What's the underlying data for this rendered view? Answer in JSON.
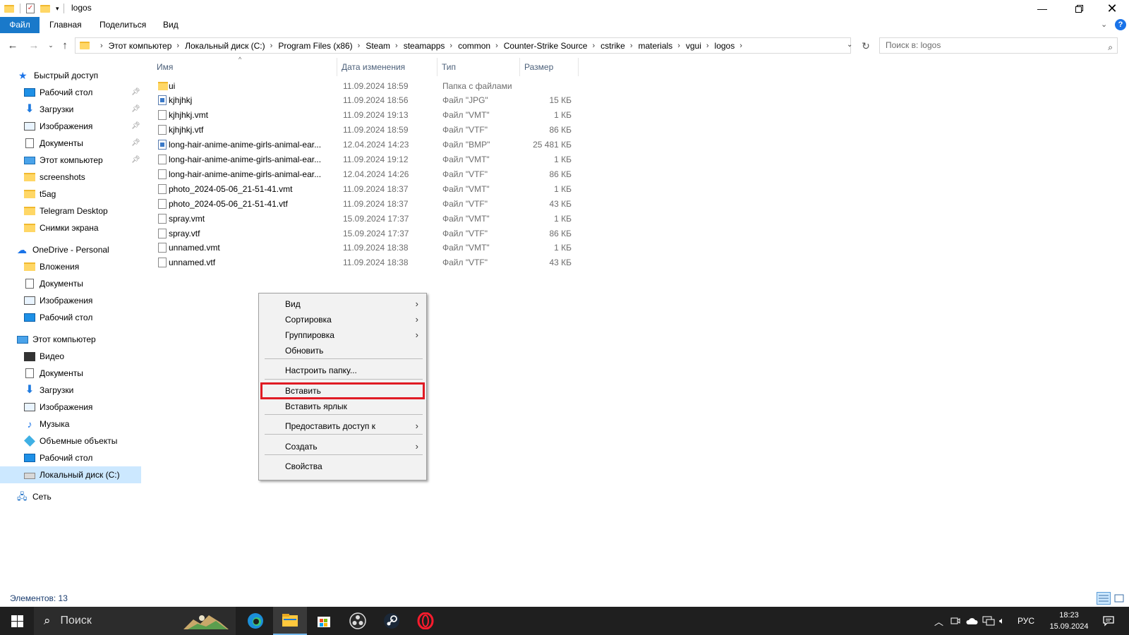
{
  "window": {
    "title": "logos"
  },
  "ribbon": {
    "tabs": [
      "Файл",
      "Главная",
      "Поделиться",
      "Вид"
    ]
  },
  "address": {
    "crumbs": [
      "Этот компьютер",
      "Локальный диск (C:)",
      "Program Files (x86)",
      "Steam",
      "steamapps",
      "common",
      "Counter-Strike Source",
      "cstrike",
      "materials",
      "vgui",
      "logos"
    ],
    "search_placeholder": "Поиск в: logos"
  },
  "nav": {
    "quick_access": "Быстрый доступ",
    "quick_items": [
      {
        "label": "Рабочий стол",
        "icon": "desktop-icon",
        "pinned": true
      },
      {
        "label": "Загрузки",
        "icon": "downloads-icon",
        "pinned": true
      },
      {
        "label": "Изображения",
        "icon": "pictures-icon",
        "pinned": true
      },
      {
        "label": "Документы",
        "icon": "documents-icon",
        "pinned": true
      },
      {
        "label": "Этот компьютер",
        "icon": "computer-icon",
        "pinned": true
      },
      {
        "label": "screenshots",
        "icon": "folder-icon",
        "pinned": false
      },
      {
        "label": "t5ag",
        "icon": "folder-icon",
        "pinned": false
      },
      {
        "label": "Telegram Desktop",
        "icon": "folder-icon",
        "pinned": false
      },
      {
        "label": "Снимки экрана",
        "icon": "folder-icon",
        "pinned": false
      }
    ],
    "onedrive": "OneDrive - Personal",
    "onedrive_items": [
      "Вложения",
      "Документы",
      "Изображения",
      "Рабочий стол"
    ],
    "this_pc": "Этот компьютер",
    "pc_items": [
      "Видео",
      "Документы",
      "Загрузки",
      "Изображения",
      "Музыка",
      "Объемные объекты",
      "Рабочий стол",
      "Локальный диск (C:)"
    ],
    "network": "Сеть"
  },
  "files": {
    "columns": [
      "Имя",
      "Дата изменения",
      "Тип",
      "Размер"
    ],
    "rows": [
      {
        "name": "ui",
        "date": "11.09.2024 18:59",
        "type": "Папка с файлами",
        "size": "",
        "kind": "folder"
      },
      {
        "name": "kjhjhkj",
        "date": "11.09.2024 18:56",
        "type": "Файл \"JPG\"",
        "size": "15 КБ",
        "kind": "image"
      },
      {
        "name": "kjhjhkj.vmt",
        "date": "11.09.2024 19:13",
        "type": "Файл \"VMT\"",
        "size": "1 КБ",
        "kind": "file"
      },
      {
        "name": "kjhjhkj.vtf",
        "date": "11.09.2024 18:59",
        "type": "Файл \"VTF\"",
        "size": "86 КБ",
        "kind": "file"
      },
      {
        "name": "long-hair-anime-anime-girls-animal-ear...",
        "date": "12.04.2024 14:23",
        "type": "Файл \"BMP\"",
        "size": "25 481 КБ",
        "kind": "image"
      },
      {
        "name": "long-hair-anime-anime-girls-animal-ear...",
        "date": "11.09.2024 19:12",
        "type": "Файл \"VMT\"",
        "size": "1 КБ",
        "kind": "file"
      },
      {
        "name": "long-hair-anime-anime-girls-animal-ear...",
        "date": "12.04.2024 14:26",
        "type": "Файл \"VTF\"",
        "size": "86 КБ",
        "kind": "file"
      },
      {
        "name": "photo_2024-05-06_21-51-41.vmt",
        "date": "11.09.2024 18:37",
        "type": "Файл \"VMT\"",
        "size": "1 КБ",
        "kind": "file"
      },
      {
        "name": "photo_2024-05-06_21-51-41.vtf",
        "date": "11.09.2024 18:37",
        "type": "Файл \"VTF\"",
        "size": "43 КБ",
        "kind": "file"
      },
      {
        "name": "spray.vmt",
        "date": "15.09.2024 17:37",
        "type": "Файл \"VMT\"",
        "size": "1 КБ",
        "kind": "file"
      },
      {
        "name": "spray.vtf",
        "date": "15.09.2024 17:37",
        "type": "Файл \"VTF\"",
        "size": "86 КБ",
        "kind": "file"
      },
      {
        "name": "unnamed.vmt",
        "date": "11.09.2024 18:38",
        "type": "Файл \"VMT\"",
        "size": "1 КБ",
        "kind": "file"
      },
      {
        "name": "unnamed.vtf",
        "date": "11.09.2024 18:38",
        "type": "Файл \"VTF\"",
        "size": "43 КБ",
        "kind": "file"
      }
    ]
  },
  "context_menu": {
    "items": [
      {
        "label": "Вид",
        "submenu": true
      },
      {
        "label": "Сортировка",
        "submenu": true
      },
      {
        "label": "Группировка",
        "submenu": true
      },
      {
        "label": "Обновить",
        "submenu": false
      },
      {
        "label": "Настроить папку...",
        "submenu": false
      },
      {
        "label": "Вставить",
        "submenu": false,
        "highlighted": true
      },
      {
        "label": "Вставить ярлык",
        "submenu": false
      },
      {
        "label": "Предоставить доступ к",
        "submenu": true
      },
      {
        "label": "Создать",
        "submenu": true
      },
      {
        "label": "Свойства",
        "submenu": false
      }
    ],
    "highlight_color": "#e01b24"
  },
  "status": {
    "count": "Элементов: 13"
  },
  "taskbar": {
    "search": "Поиск",
    "lang": "РУС",
    "time": "18:23",
    "date": "15.09.2024"
  },
  "colors": {
    "accent": "#1979ca",
    "selection": "#cce8ff",
    "taskbar": "#1f1f1f"
  }
}
